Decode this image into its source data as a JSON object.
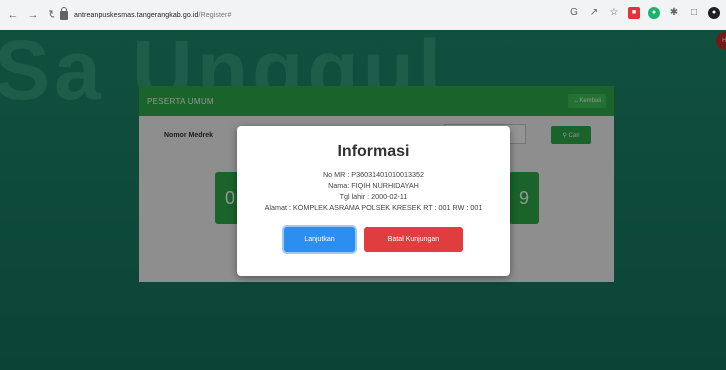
{
  "browser": {
    "url_host": "antreanpuskesmas.tangerangkab.go.id",
    "url_path": "/Register#"
  },
  "page": {
    "watermark": "Sa Unggul",
    "card_title": "PESERTA UMUM",
    "back_label": "Kembali",
    "mr_label": "Nomor Medrek",
    "cari_label": "Cari",
    "num_left": "0",
    "num_right": "9"
  },
  "modal": {
    "title": "Informasi",
    "no_mr": "No MR : P36031401010013352",
    "nama": "Nama: FIQIH NURHIDAYAH",
    "tgl_lahir": "Tgl lahir : 2000-02-11",
    "alamat": "Alamat : KOMPLEK ASRAMA POLSEK KRESEK RT : 001 RW : 001",
    "lanjutkan_label": "Lanjutkan",
    "batal_label": "Batal Kunjungan"
  },
  "colors": {
    "header_green": "#2ead4a",
    "primary_blue": "#2c8ff0",
    "danger_red": "#e03d3f"
  },
  "icons": [
    "back-arrow-icon",
    "forward-arrow-icon",
    "reload-icon",
    "lock-icon",
    "google-icon",
    "share-icon",
    "star-icon",
    "extension-icon",
    "puzzle-icon",
    "profile-icon",
    "search-icon",
    "arrow-left-icon"
  ]
}
